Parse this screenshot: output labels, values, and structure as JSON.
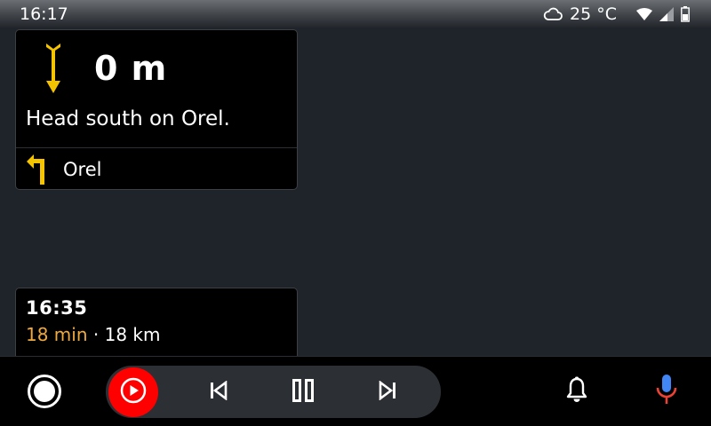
{
  "status_bar": {
    "time": "16:17",
    "weather_icon": "cloud-icon",
    "temperature": "25 °C",
    "wifi_icon": "wifi-icon",
    "signal_icon": "cellular-signal-icon",
    "battery_icon": "battery-icon"
  },
  "navigation": {
    "maneuver_icon": "arrow-down-icon",
    "distance": "0 m",
    "instruction": "Head south on Orel.",
    "next_turn_icon": "turn-left-icon",
    "next_street": "Orel"
  },
  "eta": {
    "arrival_time": "16:35",
    "duration": "18 min",
    "separator": "·",
    "distance": "18 km"
  },
  "bottom_bar": {
    "home_icon": "home-circle-icon",
    "media_app_icon": "youtube-music-icon",
    "previous_icon": "skip-previous-icon",
    "pause_icon": "pause-icon",
    "next_icon": "skip-next-icon",
    "notifications_icon": "bell-icon",
    "voice_icon": "microphone-icon"
  },
  "colors": {
    "background": "#1f232a",
    "card": "#000000",
    "accent_yellow": "#f5c400",
    "duration_orange": "#f0a93a",
    "media_red": "#ff0000",
    "mic_blue": "#4285f4",
    "mic_red": "#ea4335"
  }
}
